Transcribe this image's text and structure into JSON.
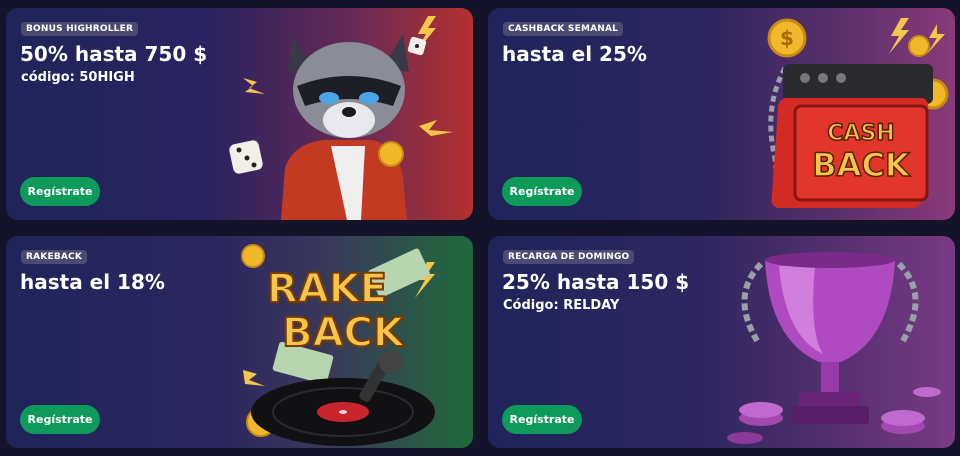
{
  "cards": [
    {
      "tag": "BONUS HIGHROLLER",
      "title": "50% hasta 750 $",
      "subtitle": "código: 50HIGH",
      "button": "Regístrate",
      "art": "raccoon-character-icon"
    },
    {
      "tag": "CASHBACK SEMANAL",
      "title": "hasta el 25%",
      "button": "Regístrate",
      "art": "cashback-toolbox-icon",
      "art_text": [
        "CASH",
        "BACK"
      ]
    },
    {
      "tag": "RAKEBACK",
      "title": "hasta el 18%",
      "button": "Regístrate",
      "art": "rakeback-vinyl-icon",
      "art_text": [
        "RAKE",
        "BACK"
      ]
    },
    {
      "tag": "RECARGA DE DOMINGO",
      "title": "25% hasta 150 $",
      "subtitle": "Código: RELDAY",
      "button": "Regístrate",
      "art": "trophy-icon"
    }
  ],
  "colors": {
    "tag_bg": "#4d4a72",
    "button_bg": "#0e9a5a",
    "page_bg": "#15132a"
  }
}
